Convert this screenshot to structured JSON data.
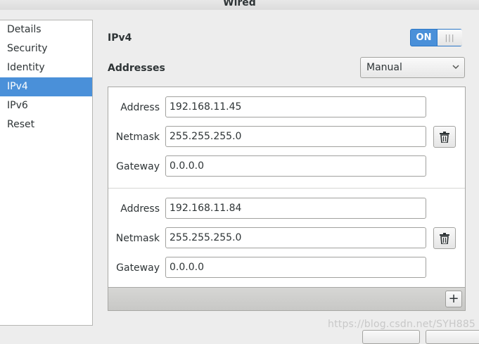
{
  "window": {
    "title": "Wired"
  },
  "sidebar": {
    "items": [
      {
        "label": "Details"
      },
      {
        "label": "Security"
      },
      {
        "label": "Identity"
      },
      {
        "label": "IPv4"
      },
      {
        "label": "IPv6"
      },
      {
        "label": "Reset"
      }
    ],
    "selected": "IPv4"
  },
  "ipv4": {
    "label": "IPv4",
    "switch_label": "ON",
    "switch_on": true
  },
  "addresses": {
    "label": "Addresses",
    "method": "Manual",
    "field_labels": {
      "address": "Address",
      "netmask": "Netmask",
      "gateway": "Gateway"
    },
    "entries": [
      {
        "address": "192.168.11.45",
        "netmask": "255.255.255.0",
        "gateway": "0.0.0.0"
      },
      {
        "address": "192.168.11.84",
        "netmask": "255.255.255.0",
        "gateway": "0.0.0.0"
      }
    ],
    "add_label": "+"
  },
  "watermark": "https://blog.csdn.net/SYH885",
  "colors": {
    "accent": "#4a90d9",
    "background": "#ededed"
  },
  "icons": {
    "delete": "trash-icon",
    "add": "plus-icon",
    "dropdown": "chevron-down-icon"
  }
}
